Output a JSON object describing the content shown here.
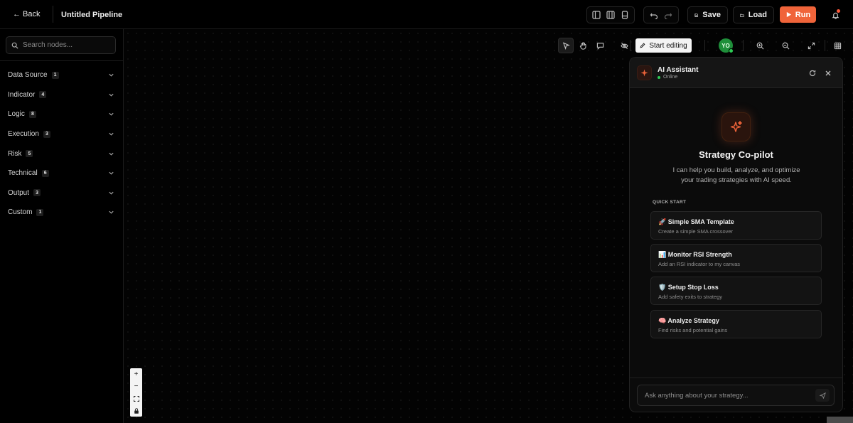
{
  "topbar": {
    "back_label": "Back",
    "pipeline_title": "Untitled Pipeline",
    "layout_icons": [
      "layout-left-icon",
      "layout-split-icon",
      "layout-bottom-icon"
    ],
    "history_icons": [
      "undo-icon",
      "redo-icon"
    ],
    "save_label": "Save",
    "load_label": "Load",
    "run_label": "Run",
    "accent_color": "#f0643a"
  },
  "sidebar": {
    "search_placeholder": "Search nodes...",
    "categories": [
      {
        "label": "Data Source",
        "count": "1"
      },
      {
        "label": "Indicator",
        "count": "4"
      },
      {
        "label": "Logic",
        "count": "8"
      },
      {
        "label": "Execution",
        "count": "3"
      },
      {
        "label": "Risk",
        "count": "5"
      },
      {
        "label": "Technical",
        "count": "6"
      },
      {
        "label": "Output",
        "count": "3"
      },
      {
        "label": "Custom",
        "count": "1"
      }
    ]
  },
  "canvas_toolbar": {
    "tools": [
      "select-icon",
      "hand-icon",
      "comment-icon",
      "hide-icon"
    ],
    "start_editing_label": "Start editing",
    "avatar_initials": "YO",
    "view_icons": [
      "zoom-in-icon",
      "zoom-out-icon",
      "fullscreen-icon",
      "grid-icon"
    ]
  },
  "assistant": {
    "title": "AI Assistant",
    "status": "Online",
    "hero_title": "Strategy Co-pilot",
    "hero_desc": "I can help you build, analyze, and optimize your trading strategies with AI speed.",
    "quick_start_label": "QUICK START",
    "quick_start": [
      {
        "emoji": "🚀",
        "title": "Simple SMA Template",
        "subtitle": "Create a simple SMA crossover"
      },
      {
        "emoji": "📊",
        "title": "Monitor RSI Strength",
        "subtitle": "Add an RSI indicator to my canvas"
      },
      {
        "emoji": "🛡️",
        "title": "Setup Stop Loss",
        "subtitle": "Add safety exits to strategy"
      },
      {
        "emoji": "🧠",
        "title": "Analyze Strategy",
        "subtitle": "Find risks and potential gains"
      }
    ],
    "input_placeholder": "Ask anything about your strategy..."
  },
  "zoom_controls": {
    "plus": "+",
    "minus": "−"
  }
}
